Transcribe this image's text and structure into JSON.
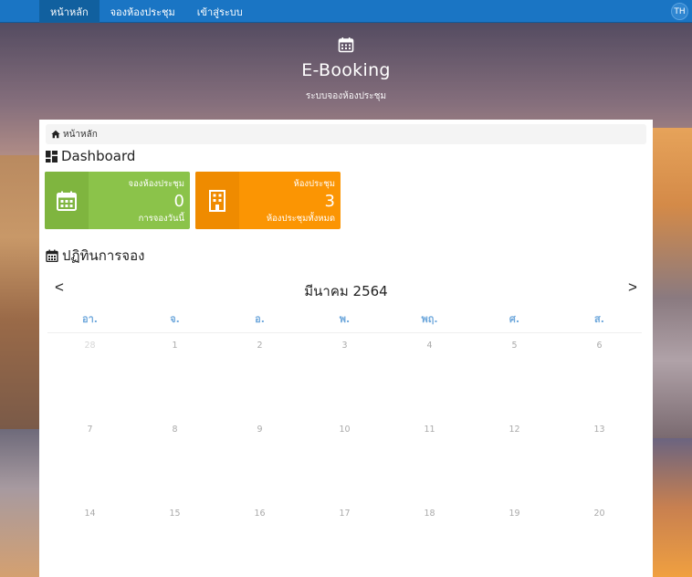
{
  "nav": {
    "items": [
      {
        "label": "หน้าหลัก",
        "active": true
      },
      {
        "label": "จองห้องประชุม",
        "active": false
      },
      {
        "label": "เข้าสู่ระบบ",
        "active": false
      }
    ],
    "lang": "TH"
  },
  "hero": {
    "title": "E-Booking",
    "subtitle": "ระบบจองห้องประชุม"
  },
  "breadcrumb": {
    "label": "หน้าหลัก"
  },
  "dashboard": {
    "title": "Dashboard",
    "cards": [
      {
        "label": "จองห้องประชุม",
        "value": "0",
        "sub": "การจองวันนี้",
        "color": "#8bc34a"
      },
      {
        "label": "ห้องประชุม",
        "value": "3",
        "sub": "ห้องประชุมทั้งหมด",
        "color": "#fb9503"
      }
    ]
  },
  "calendar": {
    "title": "ปฏิทินการจอง",
    "prev": "<",
    "next": ">",
    "month": "มีนาคม 2564",
    "dow": [
      "อา.",
      "จ.",
      "อ.",
      "พ.",
      "พฤ.",
      "ศ.",
      "ส."
    ],
    "weeks": [
      [
        "28",
        "1",
        "2",
        "3",
        "4",
        "5",
        "6"
      ],
      [
        "7",
        "8",
        "9",
        "10",
        "11",
        "12",
        "13"
      ],
      [
        "14",
        "15",
        "16",
        "17",
        "18",
        "19",
        "20"
      ]
    ]
  },
  "colors": {
    "navbar": "#1a75c4",
    "dow": "#6fa8dc"
  }
}
